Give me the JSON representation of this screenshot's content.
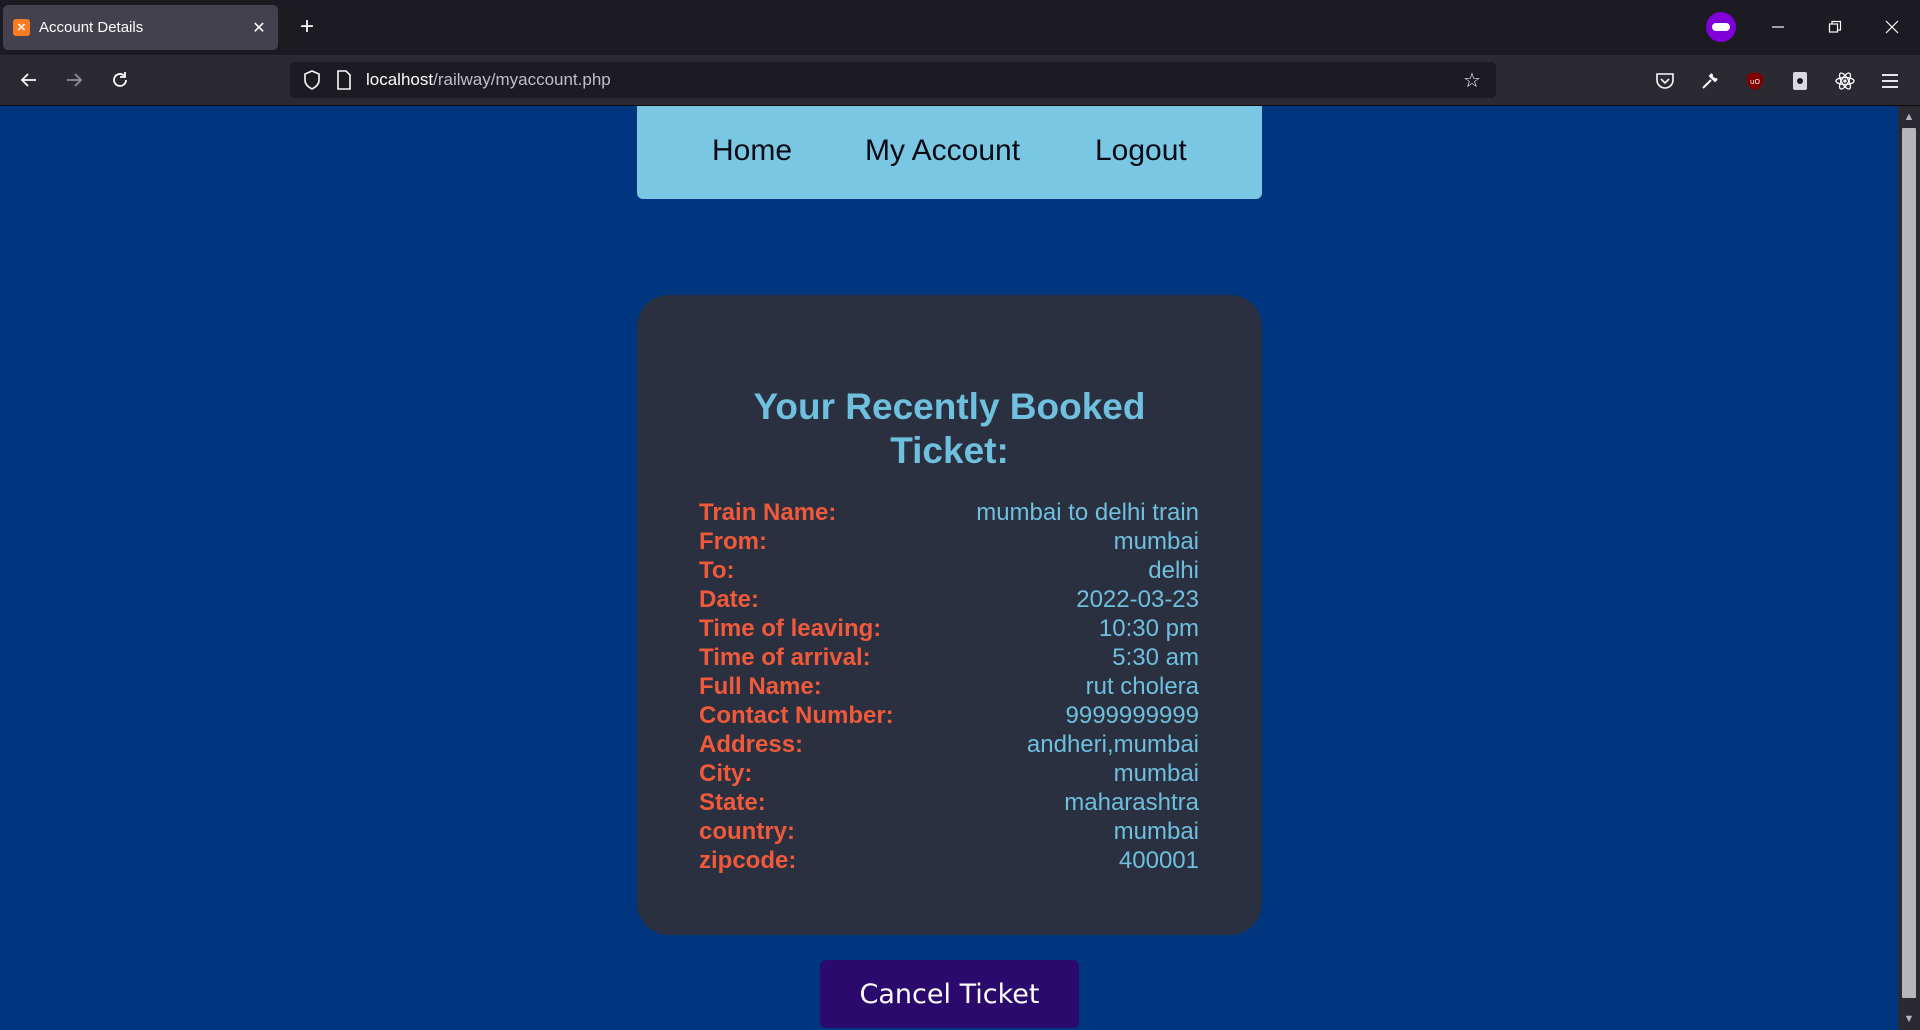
{
  "browser": {
    "tab_title": "Account Details",
    "tab_favicon": "xampp-icon",
    "url_host": "localhost",
    "url_path": "/railway/myaccount.php"
  },
  "nav": {
    "items": [
      {
        "label": "Home"
      },
      {
        "label": "My Account"
      },
      {
        "label": "Logout"
      }
    ]
  },
  "ticket": {
    "heading_line1": "Your Recently Booked",
    "heading_line2": "Ticket:",
    "fields": [
      {
        "label": "Train Name:",
        "value": "mumbai to delhi train"
      },
      {
        "label": "From:",
        "value": "mumbai"
      },
      {
        "label": "To:",
        "value": "delhi"
      },
      {
        "label": "Date:",
        "value": "2022-03-23"
      },
      {
        "label": "Time of leaving:",
        "value": "10:30 pm"
      },
      {
        "label": "Time of arrival:",
        "value": "5:30 am"
      },
      {
        "label": "Full Name:",
        "value": "rut cholera"
      },
      {
        "label": "Contact Number:",
        "value": "9999999999"
      },
      {
        "label": "Address:",
        "value": "andheri,mumbai"
      },
      {
        "label": "City:",
        "value": "mumbai"
      },
      {
        "label": "State:",
        "value": "maharashtra"
      },
      {
        "label": "country:",
        "value": "mumbai"
      },
      {
        "label": "zipcode:",
        "value": "400001"
      }
    ]
  },
  "actions": {
    "cancel_label": "Cancel Ticket"
  },
  "colors": {
    "page_bg": "#003580",
    "menu_bg": "#7ac7e3",
    "card_bg": "#2a303f",
    "label": "#f0593a",
    "value": "#6fbfdf",
    "cancel_bg": "#2b0a6e"
  }
}
